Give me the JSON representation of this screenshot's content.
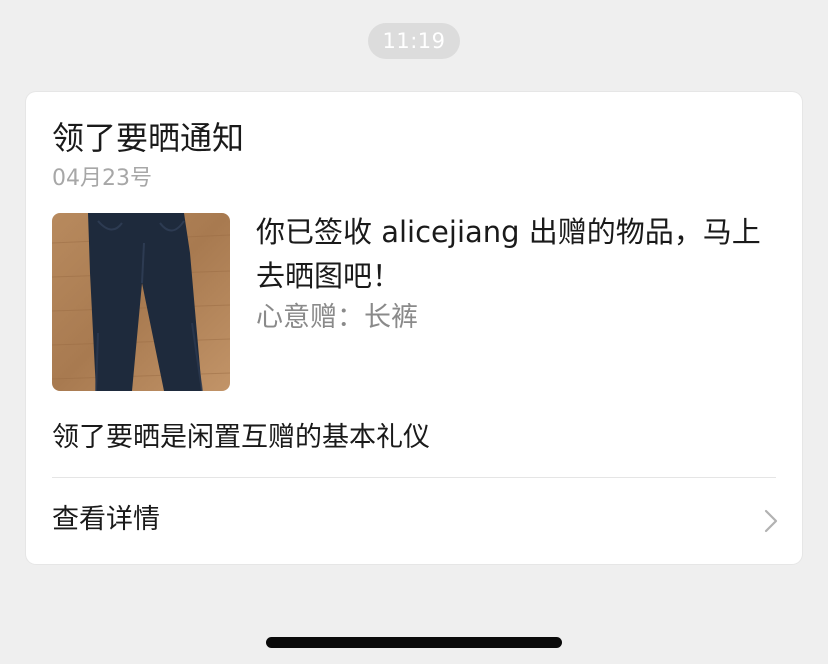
{
  "timestamp": "11:19",
  "card": {
    "title": "领了要晒通知",
    "date": "04月23号",
    "thumbnail_icon": "pants-photo",
    "message": "你已签收 alicejiang 出赠的物品，马上去晒图吧！",
    "gift_line": "心意赠：长裤",
    "note": "领了要晒是闲置互赠的基本礼仪",
    "details_label": "查看详情"
  }
}
